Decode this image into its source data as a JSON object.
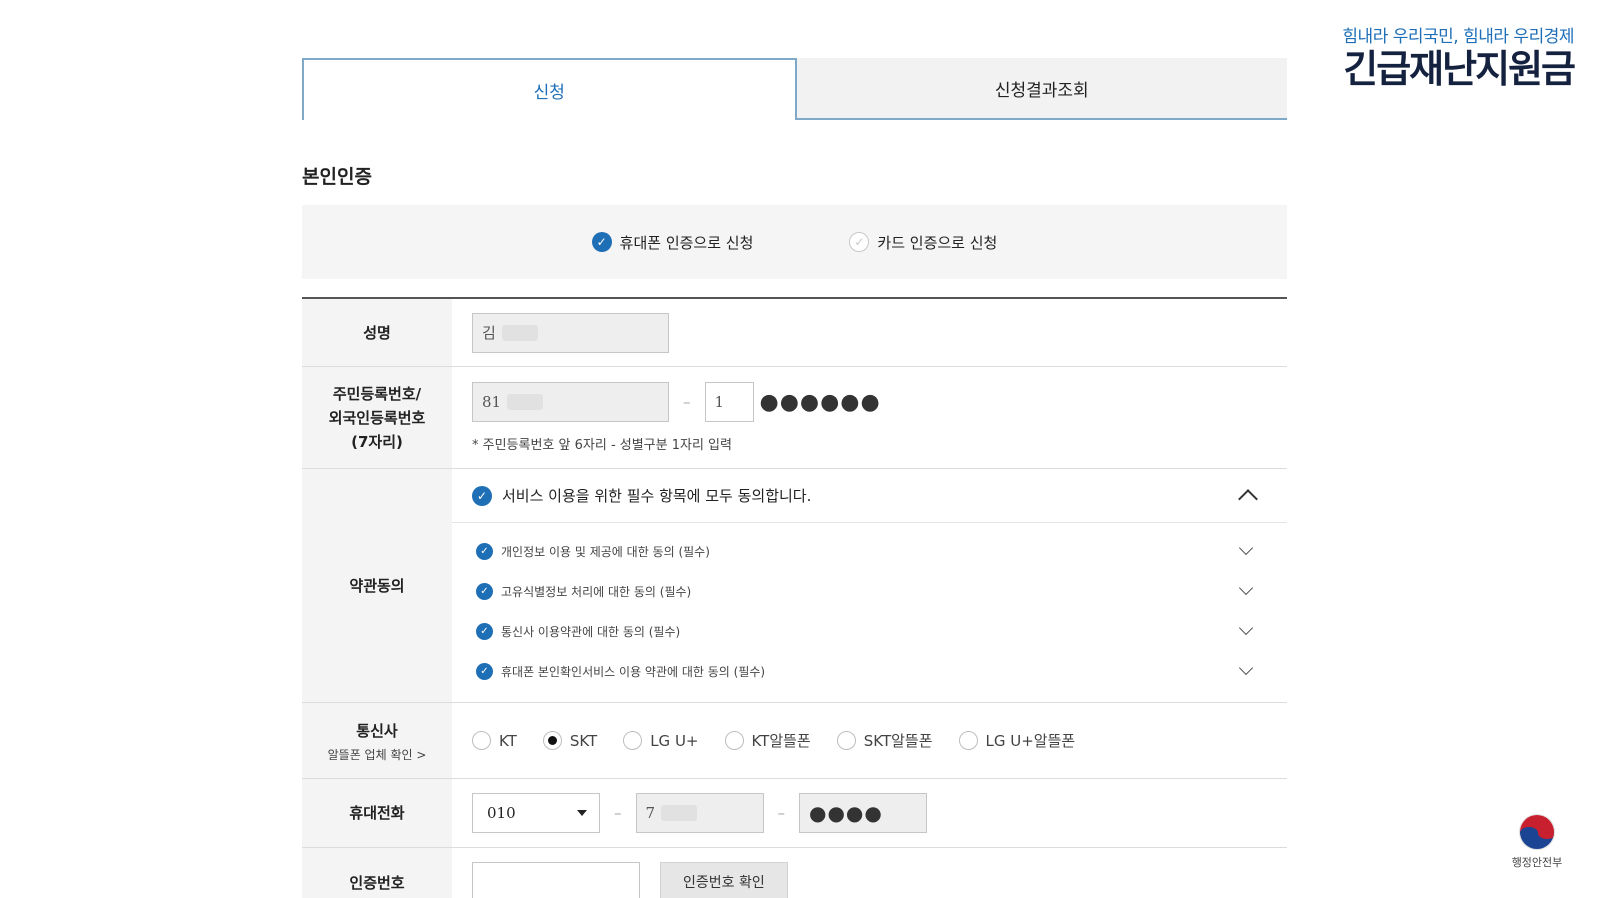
{
  "brand": {
    "slogan": "힘내라 우리국민, 힘내라 우리경제",
    "title": "긴급재난지원금",
    "ministry": "행정안전부"
  },
  "tabs": [
    {
      "label": "신청",
      "active": true
    },
    {
      "label": "신청결과조회",
      "active": false
    }
  ],
  "section_title": "본인인증",
  "auth_options": [
    {
      "label": "휴대폰 인증으로 신청",
      "checked": true
    },
    {
      "label": "카드 인증으로 신청",
      "checked": false
    }
  ],
  "form": {
    "name": {
      "label": "성명",
      "value": "김"
    },
    "resident": {
      "label_lines": [
        "주민등록번호/",
        "외국인등록번호",
        "(7자리)"
      ],
      "front_value": "81",
      "back_value": "1",
      "masked": "●●●●●●",
      "hint": "* 주민등록번호 앞 6자리 - 성별구분 1자리 입력"
    },
    "terms": {
      "label": "약관동의",
      "all_label": "서비스 이용을 위한 필수 항목에 모두 동의합니다.",
      "items": [
        "개인정보 이용 및 제공에 대한 동의 (필수)",
        "고유식별정보 처리에 대한 동의 (필수)",
        "통신사 이용약관에 대한 동의 (필수)",
        "휴대폰 본인확인서비스 이용 약관에 대한 동의 (필수)"
      ]
    },
    "carrier": {
      "label": "통신사",
      "sub_label": "알뜰폰 업체 확인 >",
      "options": [
        "KT",
        "SKT",
        "LG U+",
        "KT알뜰폰",
        "SKT알뜰폰",
        "LG U+알뜰폰"
      ],
      "selected": "SKT"
    },
    "phone": {
      "label": "휴대전화",
      "prefix": "010",
      "middle": "7",
      "last_masked": "●●●●"
    },
    "verify": {
      "label": "인증번호",
      "input_value": "",
      "button_label": "인증번호 확인"
    }
  },
  "colors": {
    "accent": "#1e6fb8",
    "check": "#1f6fb6",
    "tab_border": "#7fa9c9"
  }
}
